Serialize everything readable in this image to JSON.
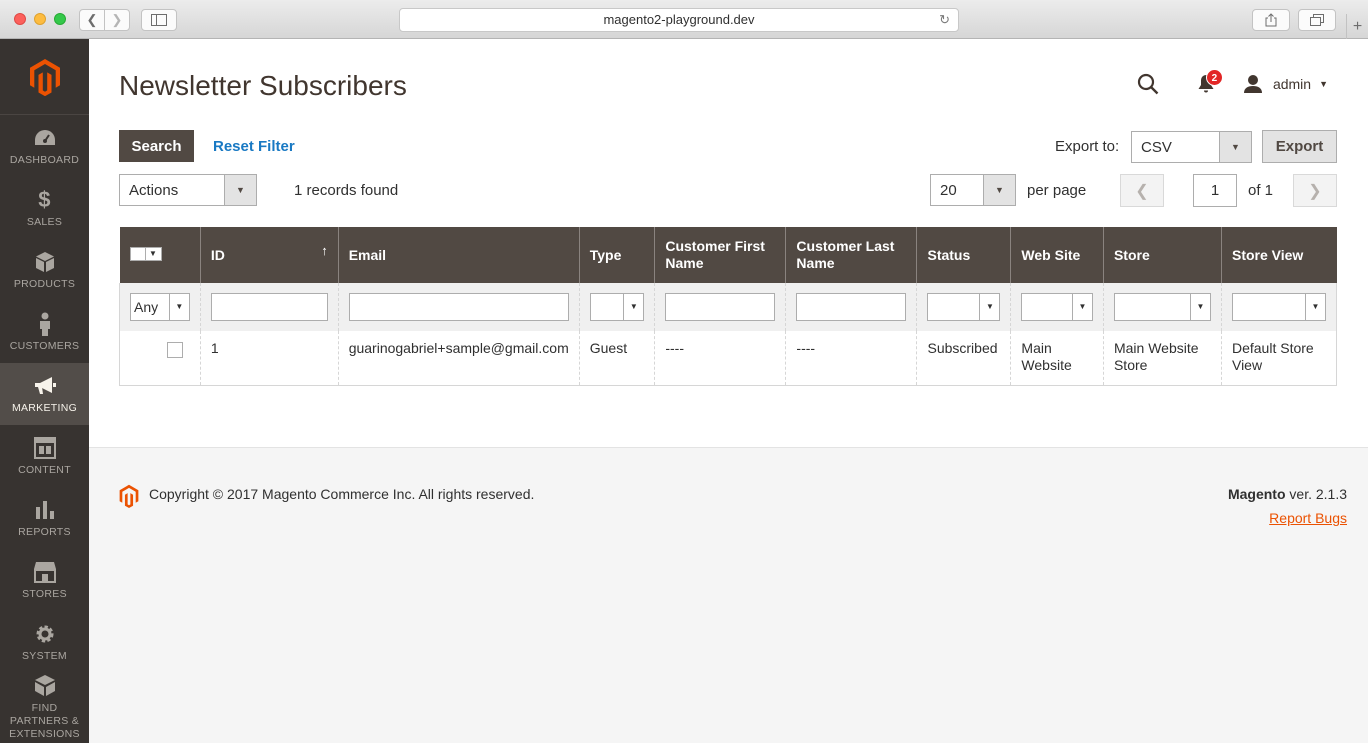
{
  "browser": {
    "url": "magento2-playground.dev"
  },
  "nav": {
    "items": [
      {
        "label": "DASHBOARD",
        "icon": "dashboard-icon"
      },
      {
        "label": "SALES",
        "icon": "dollar-icon"
      },
      {
        "label": "PRODUCTS",
        "icon": "cube-icon"
      },
      {
        "label": "CUSTOMERS",
        "icon": "person-icon"
      },
      {
        "label": "MARKETING",
        "icon": "megaphone-icon"
      },
      {
        "label": "CONTENT",
        "icon": "layout-icon"
      },
      {
        "label": "REPORTS",
        "icon": "bar-chart-icon"
      },
      {
        "label": "STORES",
        "icon": "store-icon"
      },
      {
        "label": "SYSTEM",
        "icon": "gear-icon"
      },
      {
        "label": "FIND PARTNERS & EXTENSIONS",
        "icon": "blocks-icon"
      }
    ],
    "active": "MARKETING"
  },
  "header": {
    "title": "Newsletter Subscribers",
    "notifications_count": "2",
    "user": "admin"
  },
  "toolbar": {
    "search_label": "Search",
    "reset_label": "Reset Filter",
    "export_label": "Export to:",
    "export_format": "CSV",
    "export_button": "Export",
    "actions_label": "Actions",
    "records_found": "1 records found",
    "per_page_value": "20",
    "per_page_label": "per page",
    "page_current": "1",
    "page_of": "of 1"
  },
  "grid": {
    "columns": [
      "ID",
      "Email",
      "Type",
      "Customer First Name",
      "Customer Last Name",
      "Status",
      "Web Site",
      "Store",
      "Store View"
    ],
    "filter_any": "Any",
    "rows": [
      {
        "id": "1",
        "email": "guarinogabriel+sample@gmail.com",
        "type": "Guest",
        "first_name": "----",
        "last_name": "----",
        "status": "Subscribed",
        "website": "Main Website",
        "store": "Main Website Store",
        "store_view": "Default Store View"
      }
    ]
  },
  "footer": {
    "copyright": "Copyright © 2017 Magento Commerce Inc. All rights reserved.",
    "brand": "Magento",
    "version": " ver. 2.1.3",
    "report_bugs": "Report Bugs"
  },
  "colors": {
    "accent": "#eb5202",
    "header_dark": "#514943",
    "sidebar": "#373330",
    "link": "#1979c3",
    "badge": "#e22626"
  }
}
